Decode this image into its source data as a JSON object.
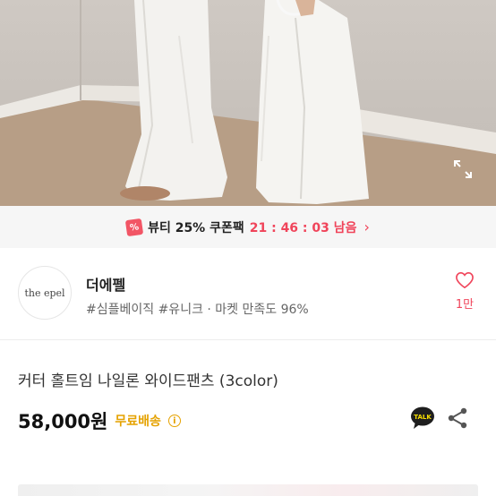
{
  "coupon": {
    "icon": "coupon-percent-icon",
    "label": "뷰티 25% 쿠폰팩",
    "timer": "21 : 46 : 03 남음",
    "accent": "#f0445a"
  },
  "shop": {
    "logo_text": "the epel",
    "name": "더에펠",
    "tags": "#심플베이직 #유니크 · 마켓 만족도 96%",
    "like_count": "1만"
  },
  "product": {
    "title": "커터 홀트임 나일론 와이드팬츠 (3color)",
    "price": "58,000원",
    "shipping": "무료배송",
    "shipping_color": "#e5a200"
  },
  "icons": {
    "expand": "expand-icon",
    "heart": "heart-icon",
    "talk": "kakaotalk-icon",
    "share": "share-icon",
    "info": "info-icon"
  }
}
